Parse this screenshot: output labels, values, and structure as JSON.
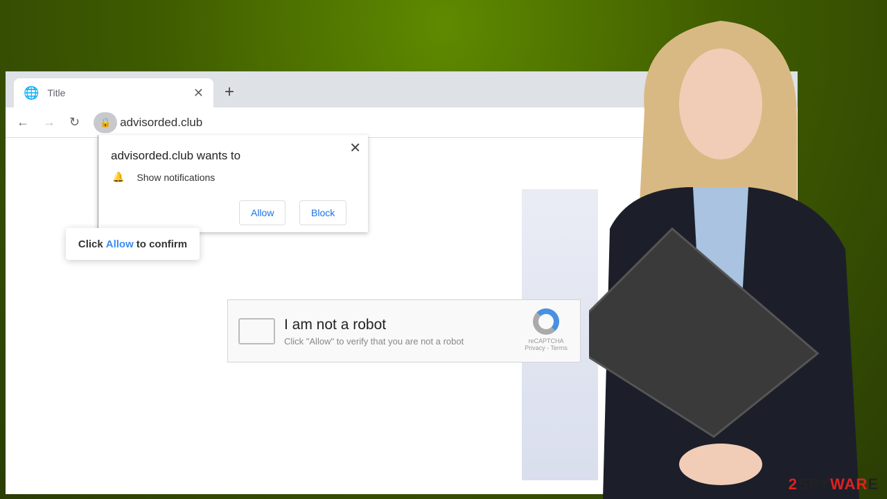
{
  "browser": {
    "tab_title": "Title",
    "url": "advisorded.club",
    "tab_close": "✕",
    "new_tab": "+",
    "window_close": "✕"
  },
  "popup": {
    "title": "advisorded.club wants to",
    "permission": "Show notifications",
    "allow": "Allow",
    "block": "Block",
    "close": "✕"
  },
  "overlay": {
    "prefix": "Click",
    "allow": "Allow",
    "suffix": "to confirm"
  },
  "captcha": {
    "title": "I am not a robot",
    "subtitle": "Click \"Allow\" to verify that you are not a robot",
    "brand": "reCAPTCHA",
    "links": "Privacy - Terms"
  },
  "watermark": {
    "text": "2SPYWARE"
  },
  "colors": {
    "accent": "#1a73e8",
    "background": "#4f7300"
  }
}
